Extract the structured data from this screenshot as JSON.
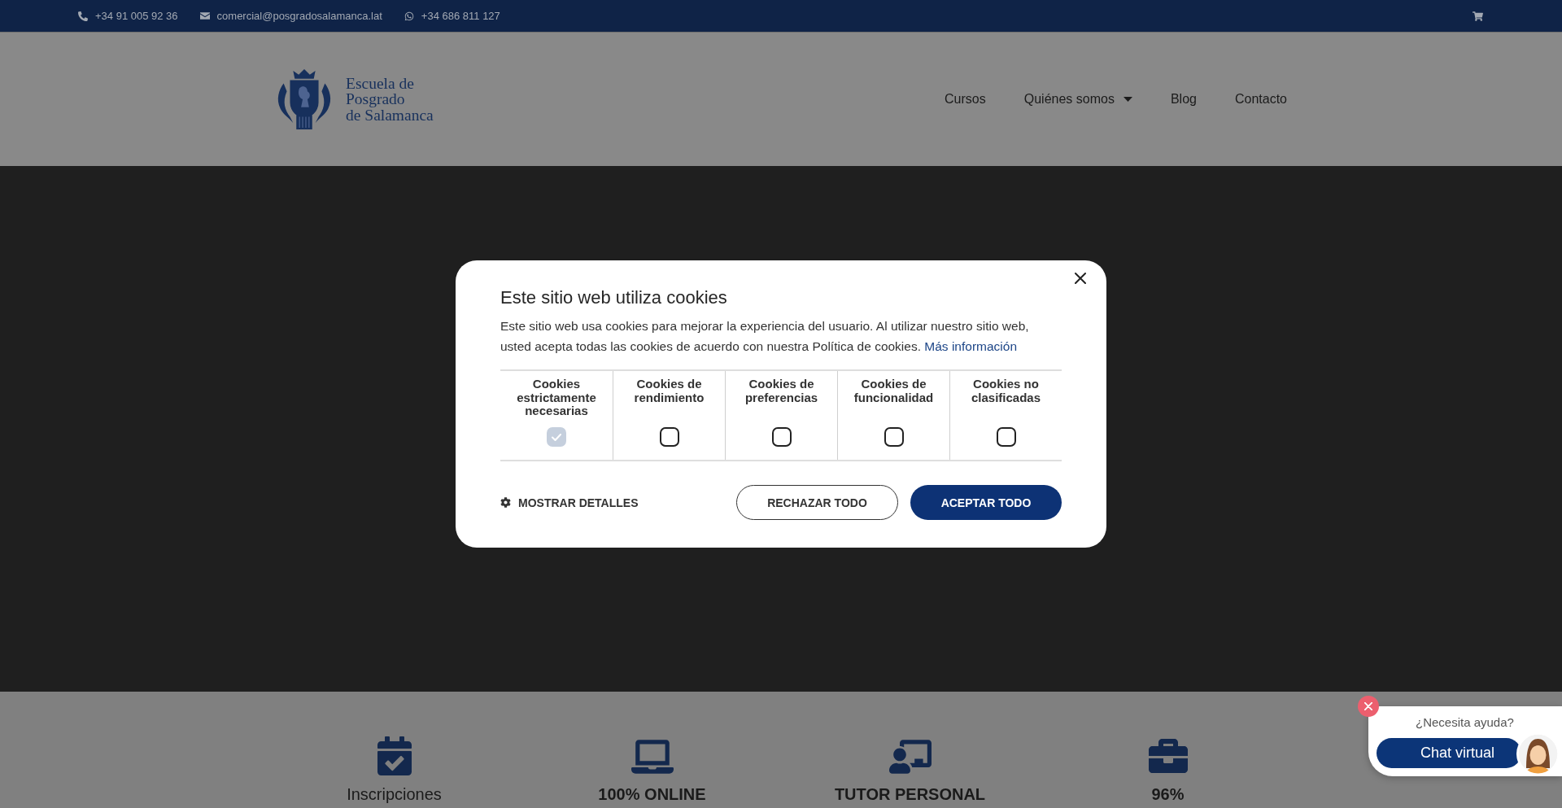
{
  "top_bar": {
    "contacts": [
      {
        "kind": "phone",
        "text": "+34 91 005 92 36"
      },
      {
        "kind": "email",
        "text": "comercial@posgradosalamanca.lat"
      },
      {
        "kind": "whatsapp",
        "text": "+34 686 811 127"
      }
    ]
  },
  "header": {
    "logo_lines": [
      "Escuela de",
      "Posgrado",
      "de Salamanca"
    ],
    "nav": [
      {
        "label": "Cursos",
        "dropdown": false
      },
      {
        "label": "Quiénes somos",
        "dropdown": true
      },
      {
        "label": "Blog",
        "dropdown": false
      },
      {
        "label": "Contacto",
        "dropdown": false
      }
    ]
  },
  "features": [
    {
      "kind": "calendar",
      "title": "Inscripciones",
      "bold": false
    },
    {
      "kind": "laptop",
      "title": "100% ONLINE",
      "bold": true
    },
    {
      "kind": "teacher",
      "title": "TUTOR PERSONAL",
      "bold": true
    },
    {
      "kind": "briefcase",
      "title": "96%",
      "bold": true
    }
  ],
  "cookie_dialog": {
    "title": "Este sitio web utiliza cookies",
    "message": "Este sitio web usa cookies para mejorar la experiencia del usuario. Al utilizar nuestro sitio web, usted acepta todas las cookies de acuerdo con nuestra Política de cookies.",
    "link": "Más información",
    "categories": [
      {
        "label": "Cookies estrictamente necesarias",
        "checked": true,
        "disabled": true
      },
      {
        "label": "Cookies de rendimiento",
        "checked": false,
        "disabled": false
      },
      {
        "label": "Cookies de preferencias",
        "checked": false,
        "disabled": false
      },
      {
        "label": "Cookies de funcionalidad",
        "checked": false,
        "disabled": false
      },
      {
        "label": "Cookies no clasificadas",
        "checked": false,
        "disabled": false
      }
    ],
    "details_button": "MOSTRAR DETALLES",
    "reject_button": "RECHAZAR TODO",
    "accept_button": "ACEPTAR TODO"
  },
  "chat_widget": {
    "prompt": "¿Necesita ayuda?",
    "button": "Chat virtual"
  }
}
